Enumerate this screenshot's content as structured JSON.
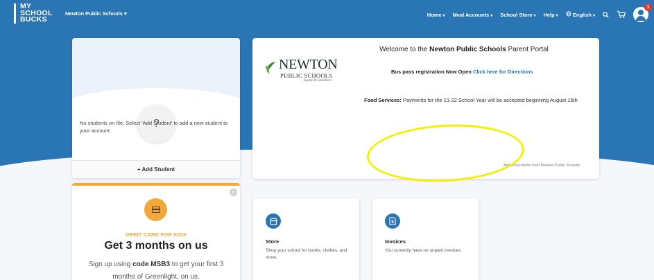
{
  "colors": {
    "brand_blue": "#2a76b5",
    "promo_orange": "#f2a93b",
    "highlight_yellow": "#f5f000"
  },
  "header": {
    "logo_lines": [
      "MY",
      "SCHOOL",
      "BUCKS"
    ],
    "district": "Newton Public Schools ▾",
    "nav": [
      {
        "label": "Home"
      },
      {
        "label": "Meal Accounts"
      },
      {
        "label": "School Store"
      },
      {
        "label": "Help"
      },
      {
        "label": "English"
      }
    ],
    "icons": [
      "globe-icon",
      "search-icon",
      "cart-icon",
      "avatar-icon"
    ],
    "avatar_badge": "1"
  },
  "students": {
    "empty_text": "No students on file. Select 'Add Student' to add a new student to your account.",
    "add_button": "+ Add Student",
    "question_glyph": "?"
  },
  "promo": {
    "close_glyph": "×",
    "eyebrow": "DEBIT CARD FOR KIDS",
    "title": "Get 3 months on us",
    "text_before": "Sign up using ",
    "code": "code MSB3",
    "text_after": " to get your first 3 months of Greenlight, on us."
  },
  "welcome": {
    "title_prefix": "Welcome to the ",
    "title_bold": "Newton Public Schools",
    "title_suffix": " Parent Portal",
    "logo": {
      "name": "NEWTON",
      "sub": "PUBLIC SCHOOLS",
      "tag": "Equity & Excellence"
    },
    "bus_text": "Bus pass registration Now Open ",
    "bus_link": "Click here for Directions",
    "food_label": "Food Services:",
    "food_text": " Payments for the 21-22 School Year will be accepted beginning August 15th",
    "announcements": "Announcements from Newton Public Schools"
  },
  "tiles": [
    {
      "title": "Store",
      "text": "Shop your school for books, clothes, and more.",
      "icon": "store-icon"
    },
    {
      "title": "Invoices",
      "text": "You currently have no unpaid invoices.",
      "icon": "invoice-icon"
    }
  ]
}
